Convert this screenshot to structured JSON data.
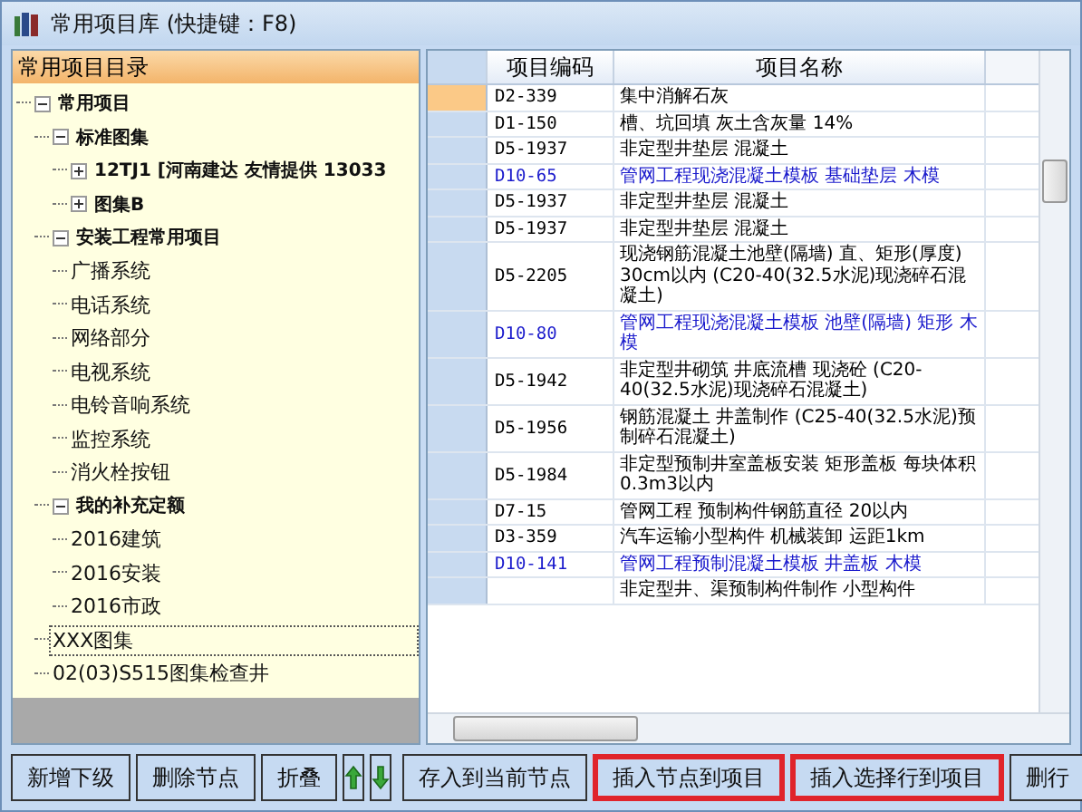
{
  "window": {
    "title": "常用项目库 (快捷键：F8)"
  },
  "tree": {
    "header": "常用项目目录",
    "items": [
      {
        "label": "常用项目",
        "bold": true,
        "expanded": true,
        "selected": false,
        "children": [
          {
            "label": "标准图集",
            "bold": true,
            "expanded": true,
            "selected": false,
            "children": [
              {
                "label": "12TJ1 [河南建达 友情提供 13033",
                "bold": true,
                "expanded": false,
                "selected": false
              },
              {
                "label": "图集B",
                "bold": true,
                "expanded": false,
                "selected": false
              }
            ]
          },
          {
            "label": "安装工程常用项目",
            "bold": true,
            "expanded": true,
            "selected": false,
            "children": [
              {
                "label": "广播系统",
                "bold": false,
                "selected": false
              },
              {
                "label": "电话系统",
                "bold": false,
                "selected": false
              },
              {
                "label": "网络部分",
                "bold": false,
                "selected": false
              },
              {
                "label": "电视系统",
                "bold": false,
                "selected": false
              },
              {
                "label": "电铃音响系统",
                "bold": false,
                "selected": false
              },
              {
                "label": "监控系统",
                "bold": false,
                "selected": false
              },
              {
                "label": "消火栓按钮",
                "bold": false,
                "selected": false
              }
            ]
          },
          {
            "label": "我的补充定额",
            "bold": true,
            "expanded": true,
            "selected": false,
            "children": [
              {
                "label": "2016建筑",
                "bold": false,
                "selected": false
              },
              {
                "label": "2016安装",
                "bold": false,
                "selected": false
              },
              {
                "label": "2016市政",
                "bold": false,
                "selected": false
              }
            ]
          },
          {
            "label": "XXX图集",
            "bold": false,
            "selected": true
          },
          {
            "label": "02(03)S515图集检查井",
            "bold": false,
            "selected": false
          }
        ]
      }
    ]
  },
  "table": {
    "columns": [
      "项目编码",
      "项目名称"
    ],
    "rows": [
      {
        "code": "D2-339",
        "name": "集中消解石灰",
        "color": "#000000",
        "selected": true
      },
      {
        "code": "D1-150",
        "name": "槽、坑回填 灰土含灰量 14%",
        "color": "#000000",
        "selected": false
      },
      {
        "code": "D5-1937",
        "name": "非定型井垫层 混凝土",
        "color": "#000000",
        "selected": false
      },
      {
        "code": "D10-65",
        "name": "管网工程现浇混凝土模板 基础垫层 木模",
        "color": "#1a1acc",
        "selected": false
      },
      {
        "code": "D5-1937",
        "name": "非定型井垫层 混凝土",
        "color": "#000000",
        "selected": false
      },
      {
        "code": "D5-1937",
        "name": "非定型井垫层 混凝土",
        "color": "#000000",
        "selected": false
      },
      {
        "code": "D5-2205",
        "name": "现浇钢筋混凝土池壁(隔墙) 直、矩形(厚度) 30cm以内 (C20-40(32.5水泥)现浇碎石混凝土)",
        "color": "#000000",
        "selected": false
      },
      {
        "code": "D10-80",
        "name": "管网工程现浇混凝土模板 池壁(隔墙) 矩形 木模",
        "color": "#1a1acc",
        "selected": false
      },
      {
        "code": "D5-1942",
        "name": "非定型井砌筑 井底流槽 现浇砼 (C20-40(32.5水泥)现浇碎石混凝土)",
        "color": "#000000",
        "selected": false
      },
      {
        "code": "D5-1956",
        "name": "钢筋混凝土 井盖制作 (C25-40(32.5水泥)预制碎石混凝土)",
        "color": "#000000",
        "selected": false
      },
      {
        "code": "D5-1984",
        "name": "非定型预制井室盖板安装 矩形盖板 每块体积0.3m3以内",
        "color": "#000000",
        "selected": false
      },
      {
        "code": "D7-15",
        "name": "管网工程 预制构件钢筋直径 20以内",
        "color": "#000000",
        "selected": false
      },
      {
        "code": "D3-359",
        "name": "汽车运输小型构件 机械装卸 运距1km",
        "color": "#000000",
        "selected": false
      },
      {
        "code": "D10-141",
        "name": "管网工程预制混凝土模板 井盖板 木模",
        "color": "#1a1acc",
        "selected": false
      },
      {
        "code": "",
        "name": "非定型井、渠预制构件制作 小型构件",
        "color": "#000000",
        "selected": false
      }
    ]
  },
  "left_buttons": [
    {
      "kind": "text",
      "label": "新增下级"
    },
    {
      "kind": "text",
      "label": "删除节点"
    },
    {
      "kind": "text",
      "label": "折叠"
    },
    {
      "kind": "up"
    },
    {
      "kind": "down"
    }
  ],
  "right_buttons": [
    {
      "label": "存入到当前节点",
      "highlighted": false
    },
    {
      "label": "插入节点到项目",
      "highlighted": true
    },
    {
      "label": "插入选择行到项目",
      "highlighted": true
    },
    {
      "label": "删行",
      "highlighted": false
    }
  ]
}
